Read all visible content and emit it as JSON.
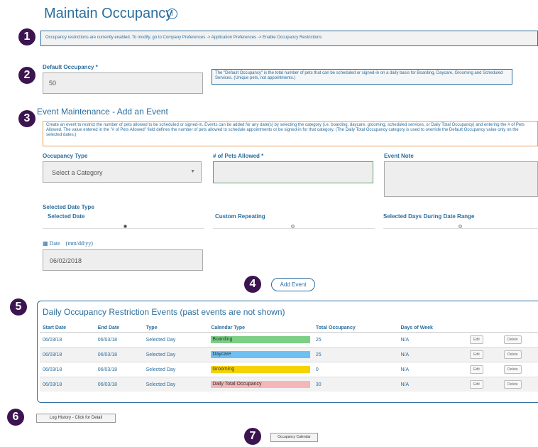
{
  "page": {
    "title": "Maintain Occupancy",
    "info_icon": "i"
  },
  "badges": [
    "1",
    "2",
    "3",
    "4",
    "5",
    "6",
    "7"
  ],
  "notice": "Occupancy restrictions are currently enabled. To modify, go to Company Preferences -> Application Preferences -> Enable Occupancy Restrictions",
  "default_occupancy": {
    "label": "Default Occupancy *",
    "value": "50",
    "help": "The \"Default Occupancy\" is the total number of pets that can be scheduled or signed-in on a daily basis for Boarding, Daycare, Grooming and Scheduled Services. (Unique pets, not appointments.)"
  },
  "event": {
    "section_title": "Event Maintenance - Add an Event",
    "description": "Create an event to restrict the number of pets allowed to be scheduled or signed-in. Events can be added for any date(s) by selecting the category (i.e. boarding, daycare, grooming, scheduled services, or Daily Total Occupancy) and entering the # of Pets Allowed. The value entered in the \"# of Pets Allowed\" field defines the number of pets allowed to schedule appointments or be signed-in for that category. (The Daily Total Occupancy category is used to override the Default Occupancy value only on the selected dates.)",
    "occupancy_type_label": "Occupancy Type",
    "occupancy_type_value": "Select a Category",
    "pets_allowed_label": "# of Pets Allowed *",
    "pets_allowed_value": "",
    "note_label": "Event Note",
    "note_value": "",
    "date_type_label": "Selected Date Type",
    "date_types": [
      {
        "label": "Selected Date",
        "selected": true
      },
      {
        "label": "Custom Repeating",
        "selected": false
      },
      {
        "label": "Selected Days During Date Range",
        "selected": false
      }
    ],
    "date_label": "Date",
    "date_format": "(mm/dd/yy)",
    "date_value": "06/02/2018",
    "add_button": "Add Event"
  },
  "events_table": {
    "title": "Daily Occupancy Restriction Events (past events are not shown)",
    "columns": [
      "Start Date",
      "End Date",
      "Type",
      "Calendar Type",
      "Total Occupancy",
      "Days of Week",
      "",
      ""
    ],
    "rows": [
      {
        "start": "06/03/18",
        "end": "06/03/18",
        "type": "Selected Day",
        "calendar": "Boarding",
        "color": "#7ccf86",
        "total": "25",
        "days": "N/A",
        "edit": "Edit",
        "delete": "Delete"
      },
      {
        "start": "06/03/18",
        "end": "06/03/18",
        "type": "Selected Day",
        "calendar": "Daycare",
        "color": "#6cc0f2",
        "total": "25",
        "days": "N/A",
        "edit": "Edit",
        "delete": "Delete"
      },
      {
        "start": "06/03/18",
        "end": "06/03/18",
        "type": "Selected Day",
        "calendar": "Grooming",
        "color": "#f5d300",
        "total": "0",
        "days": "N/A",
        "edit": "Edit",
        "delete": "Delete"
      },
      {
        "start": "06/03/18",
        "end": "06/03/18",
        "type": "Selected Day",
        "calendar": "Daily Total Occupancy",
        "color": "#f4b6b6",
        "total": "30",
        "days": "N/A",
        "edit": "Edit",
        "delete": "Delete"
      }
    ]
  },
  "log_history_button": "Log History - Click for Detail",
  "calendar_button": "Occupancy Calendar",
  "colors": {
    "accent": "#2b6e9e",
    "badge": "#3b1450"
  }
}
